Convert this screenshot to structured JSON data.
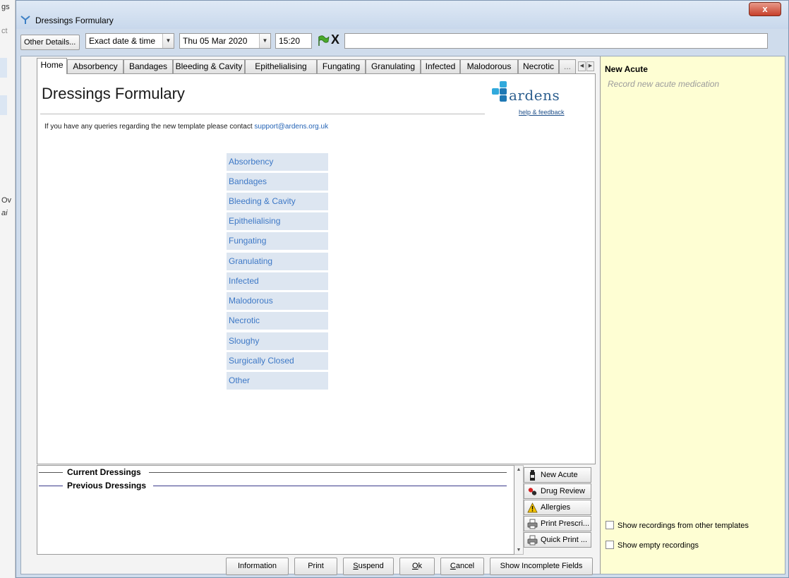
{
  "background": {
    "fragments": [
      "gs",
      "ct",
      "Ov",
      "ai"
    ]
  },
  "window": {
    "title": "Dressings Formulary",
    "close_label": "x"
  },
  "toolbar": {
    "other_details": "Other Details...",
    "date_mode": "Exact date & time",
    "date": "Thu 05 Mar 2020",
    "time": "15:20",
    "clear_label": "X",
    "free_text": ""
  },
  "tabs": [
    "Home",
    "Absorbency",
    "Bandages",
    "Bleeding & Cavity",
    "Epithelialising",
    "Fungating",
    "Granulating",
    "Infected",
    "Malodorous",
    "Necrotic",
    "..."
  ],
  "page": {
    "title": "Dressings Formulary",
    "info_text": "If you have any queries regarding the new template please contact",
    "info_link": "support@ardens.org.uk",
    "logo_word": "ardens",
    "logo_feedback": "help & feedback"
  },
  "formulary": [
    "Absorbency",
    "Bandages",
    "Bleeding & Cavity",
    "Epithelialising",
    "Fungating",
    "Granulating",
    "Infected",
    "Malodorous",
    "Necrotic",
    "Sloughy",
    "Surgically Closed",
    "Other"
  ],
  "sections": {
    "current": "Current Dressings",
    "previous": "Previous Dressings"
  },
  "side_buttons": [
    "New Acute",
    "Drug Review",
    "Allergies",
    "Print Prescri...",
    "Quick Print ..."
  ],
  "right_panel": {
    "title": "New Acute",
    "subtitle": "Record new acute medication",
    "check1": "Show recordings from other templates",
    "check2": "Show empty recordings"
  },
  "bottom_buttons": {
    "information": "Information",
    "print": "Print",
    "suspend_key": "S",
    "suspend_rest": "uspend",
    "ok_key": "O",
    "ok_rest": "k",
    "cancel_key": "C",
    "cancel_rest": "ancel",
    "incomplete": "Show Incomplete Fields"
  },
  "colors": {
    "accent": "#3d78c6",
    "formulary_bg": "#dde6f1",
    "right_panel_bg": "#fefed3"
  }
}
